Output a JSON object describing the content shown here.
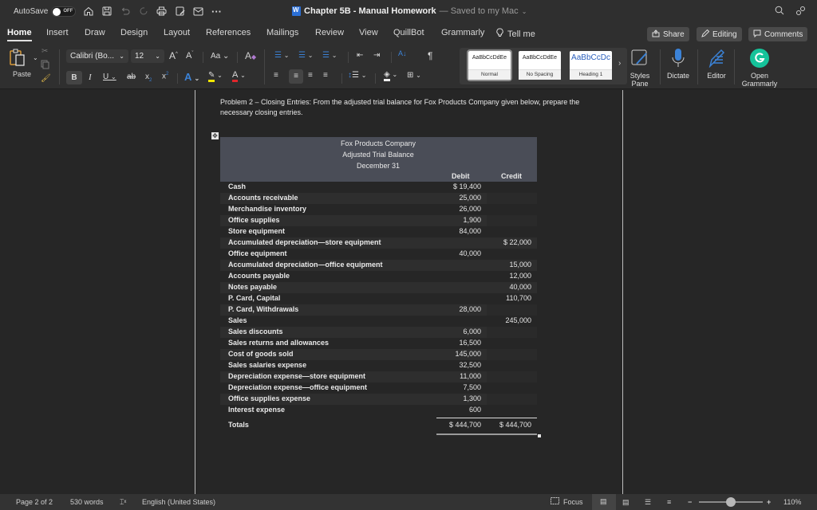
{
  "titlebar": {
    "autosave_label": "AutoSave",
    "autosave_state": "OFF",
    "doc_title": "Chapter 5B - Manual Homework",
    "saved_status": "— Saved to my Mac",
    "quick_access_icons": [
      "home-icon",
      "save-icon",
      "undo-icon",
      "redo-icon",
      "print-icon",
      "edit-doc-icon",
      "email-icon",
      "more-icon"
    ]
  },
  "tabs": {
    "items": [
      "Home",
      "Insert",
      "Draw",
      "Design",
      "Layout",
      "References",
      "Mailings",
      "Review",
      "View",
      "QuillBot",
      "Grammarly"
    ],
    "active": "Home",
    "tell_me": "Tell me",
    "share": "Share",
    "editing": "Editing",
    "comments": "Comments"
  },
  "ribbon": {
    "paste": "Paste",
    "font_name": "Calibri (Bo...",
    "font_size": "12",
    "styles": [
      {
        "sample": "AaBbCcDdEe",
        "label": "Normal"
      },
      {
        "sample": "AaBbCcDdEe",
        "label": "No Spacing"
      },
      {
        "sample": "AaBbCcDc",
        "label": "Heading 1"
      }
    ],
    "styles_pane": "Styles Pane",
    "dictate": "Dictate",
    "editor": "Editor",
    "open_grammarly": "Open Grammarly",
    "colors": {
      "highlight": "#f2e600",
      "font_color": "#e0262b",
      "grammarly": "#15c39a",
      "accent": "#3b82d6"
    }
  },
  "document": {
    "problem_text": "Problem 2 – Closing Entries: From the adjusted trial balance for Fox Products Company given below, prepare the necessary closing entries.",
    "table": {
      "company": "Fox Products Company",
      "title": "Adjusted Trial Balance",
      "date": "December 31",
      "col_debit": "Debit",
      "col_credit": "Credit",
      "rows": [
        {
          "account": "Cash",
          "debit": "$ 19,400",
          "credit": ""
        },
        {
          "account": "Accounts receivable",
          "debit": "25,000",
          "credit": ""
        },
        {
          "account": "Merchandise inventory",
          "debit": "26,000",
          "credit": ""
        },
        {
          "account": "Office supplies",
          "debit": "1,900",
          "credit": ""
        },
        {
          "account": "Store equipment",
          "debit": "84,000",
          "credit": ""
        },
        {
          "account": "Accumulated depreciation—store equipment",
          "debit": "",
          "credit": "$ 22,000"
        },
        {
          "account": "Office equipment",
          "debit": "40,000",
          "credit": ""
        },
        {
          "account": "Accumulated depreciation—office equipment",
          "debit": "",
          "credit": "15,000"
        },
        {
          "account": "Accounts payable",
          "debit": "",
          "credit": "12,000"
        },
        {
          "account": "Notes payable",
          "debit": "",
          "credit": "40,000"
        },
        {
          "account": "P. Card, Capital",
          "debit": "",
          "credit": "110,700"
        },
        {
          "account": "P. Card, Withdrawals",
          "debit": "28,000",
          "credit": ""
        },
        {
          "account": "Sales",
          "debit": "",
          "credit": "245,000"
        },
        {
          "account": "Sales discounts",
          "debit": "6,000",
          "credit": ""
        },
        {
          "account": "Sales returns and allowances",
          "debit": "16,500",
          "credit": ""
        },
        {
          "account": "Cost of goods sold",
          "debit": "145,000",
          "credit": ""
        },
        {
          "account": "Sales salaries expense",
          "debit": "32,500",
          "credit": ""
        },
        {
          "account": "Depreciation expense—store equipment",
          "debit": "11,000",
          "credit": ""
        },
        {
          "account": "Depreciation expense—office equipment",
          "debit": "7,500",
          "credit": ""
        },
        {
          "account": "Office supplies expense",
          "debit": "1,300",
          "credit": ""
        },
        {
          "account": "Interest expense",
          "debit": "600",
          "credit": ""
        }
      ],
      "totals": {
        "label": "Totals",
        "debit": "$ 444,700",
        "credit": "$ 444,700"
      }
    }
  },
  "statusbar": {
    "page": "Page 2 of 2",
    "words": "530 words",
    "language": "English (United States)",
    "focus": "Focus",
    "zoom": "110%",
    "zoom_level_percent": 110
  }
}
